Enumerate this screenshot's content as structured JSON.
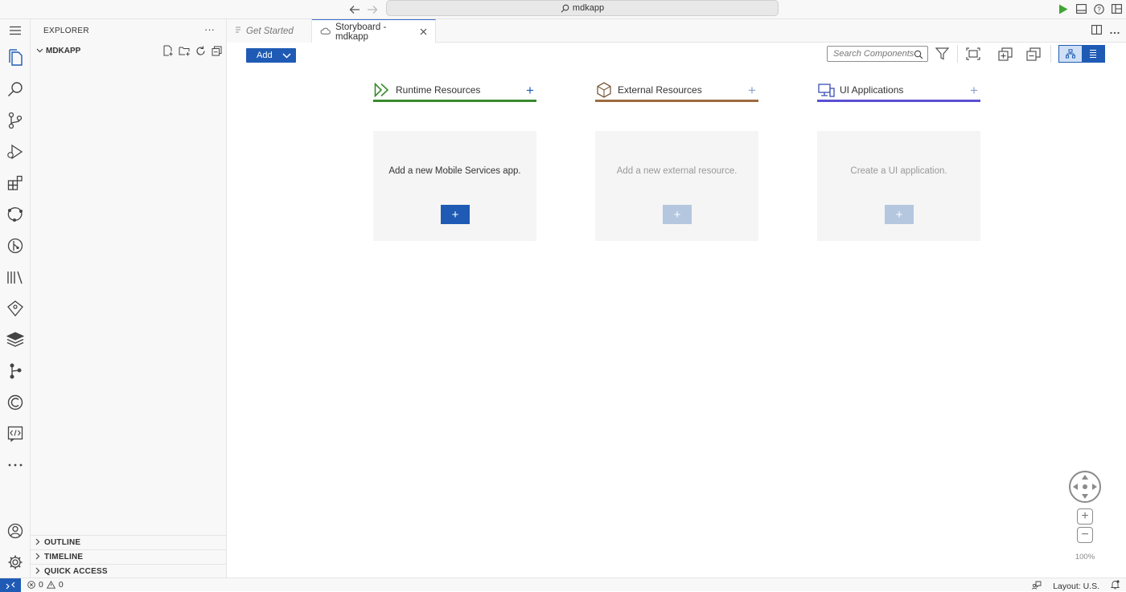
{
  "titlebar": {
    "back_icon": "arrow-left-icon",
    "forward_icon": "arrow-right-icon",
    "command_center": "mdkapp"
  },
  "sidebar": {
    "title": "EXPLORER",
    "more": "···",
    "folder": "MDKAPP",
    "sections": [
      "OUTLINE",
      "TIMELINE",
      "QUICK ACCESS"
    ]
  },
  "tabs": [
    {
      "label": "Get Started",
      "active": false
    },
    {
      "label": "Storyboard - mdkapp",
      "active": true
    }
  ],
  "toolbar": {
    "add_label": "Add",
    "search_placeholder": "Search Components"
  },
  "columns": [
    {
      "title": "Runtime Resources",
      "accent": "#3a8a2e",
      "message": "Add a new Mobile Services app.",
      "button_color": "#1f5bb5",
      "enabled": true
    },
    {
      "title": "External Resources",
      "accent": "#9c6b3f",
      "message": "Add a new external resource.",
      "button_color": "#b4c7df",
      "enabled": false
    },
    {
      "title": "UI Applications",
      "accent": "#5b4fd1",
      "message": "Create a UI application.",
      "button_color": "#b4c7df",
      "enabled": false
    }
  ],
  "zoom": {
    "level": "100%",
    "in": "+",
    "out": "−"
  },
  "statusbar": {
    "errors": "0",
    "warnings": "0",
    "layout": "Layout: U.S."
  },
  "colors": {
    "accent_blue": "#1f5bb5",
    "run_green": "#3fa535"
  }
}
